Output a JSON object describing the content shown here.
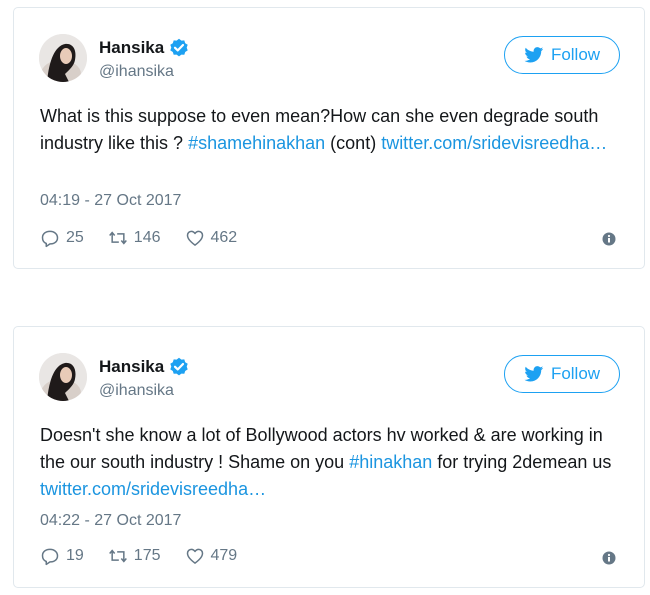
{
  "tweets": [
    {
      "author": {
        "name": "Hansika",
        "handle": "@ihansika"
      },
      "follow_label": "Follow",
      "text_parts": [
        "What is this suppose to even mean?How can she even degrade south industry like this ? ",
        "#shamehinakhan",
        " (cont) ",
        "twitter.com/sridevisreedha…"
      ],
      "timestamp": "04:19 - 27 Oct 2017",
      "stats": {
        "replies": "25",
        "retweets": "146",
        "likes": "462"
      }
    },
    {
      "author": {
        "name": "Hansika",
        "handle": "@ihansika"
      },
      "follow_label": "Follow",
      "text_parts": [
        "Doesn't she know a lot of Bollywood actors hv worked & are working in the our south industry ! Shame on you ",
        "#hinakhan",
        " for trying 2demean us ",
        "twitter.com/sridevisreedha…"
      ],
      "timestamp": "04:22 - 27 Oct 2017",
      "stats": {
        "replies": "19",
        "retweets": "175",
        "likes": "479"
      }
    }
  ],
  "colors": {
    "accent": "#1da1f2",
    "link": "#1b95e0",
    "muted": "#657786",
    "text": "#14171a",
    "border": "#e1e8ed"
  },
  "icons": [
    "verified-badge-icon",
    "twitter-bird-icon",
    "reply-icon",
    "retweet-icon",
    "like-heart-icon",
    "info-icon"
  ]
}
